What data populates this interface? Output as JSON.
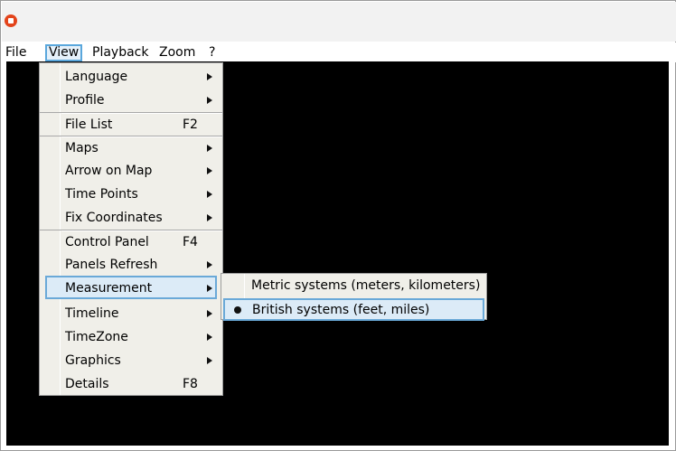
{
  "menubar": {
    "items": [
      "File",
      "View",
      "Playback",
      "Zoom",
      "?"
    ]
  },
  "view_menu": {
    "items": [
      {
        "label": "Language",
        "shortcut": "",
        "submenu": true
      },
      {
        "label": "Profile",
        "shortcut": "",
        "submenu": true
      },
      {
        "label": "File List",
        "shortcut": "F2",
        "submenu": false
      },
      {
        "label": "Maps",
        "shortcut": "",
        "submenu": true
      },
      {
        "label": "Arrow on Map",
        "shortcut": "",
        "submenu": true
      },
      {
        "label": "Time Points",
        "shortcut": "",
        "submenu": true
      },
      {
        "label": "Fix Coordinates",
        "shortcut": "",
        "submenu": true
      },
      {
        "label": "Control Panel",
        "shortcut": "F4",
        "submenu": false
      },
      {
        "label": "Panels Refresh",
        "shortcut": "",
        "submenu": true
      },
      {
        "label": "Measurement",
        "shortcut": "",
        "submenu": true,
        "highlighted": true
      },
      {
        "label": "Timeline",
        "shortcut": "",
        "submenu": true
      },
      {
        "label": "TimeZone",
        "shortcut": "",
        "submenu": true
      },
      {
        "label": "Graphics",
        "shortcut": "",
        "submenu": true
      },
      {
        "label": "Details",
        "shortcut": "F8",
        "submenu": false
      }
    ]
  },
  "measurement_submenu": {
    "items": [
      {
        "label": "Metric systems (meters, kilometers)",
        "selected": false
      },
      {
        "label": "British systems (feet, miles)",
        "selected": true,
        "highlighted": true
      }
    ]
  },
  "colors": {
    "canvas": "#000000",
    "menu_bg": "#f0efe9",
    "highlight_border": "#6aa9d8",
    "highlight_bg": "#dcebf7",
    "app_icon": "#e3441b"
  },
  "icons": {
    "app": "app-logo-icon",
    "submenu": "submenu-arrow-icon",
    "selected": "radio-bullet-icon"
  }
}
